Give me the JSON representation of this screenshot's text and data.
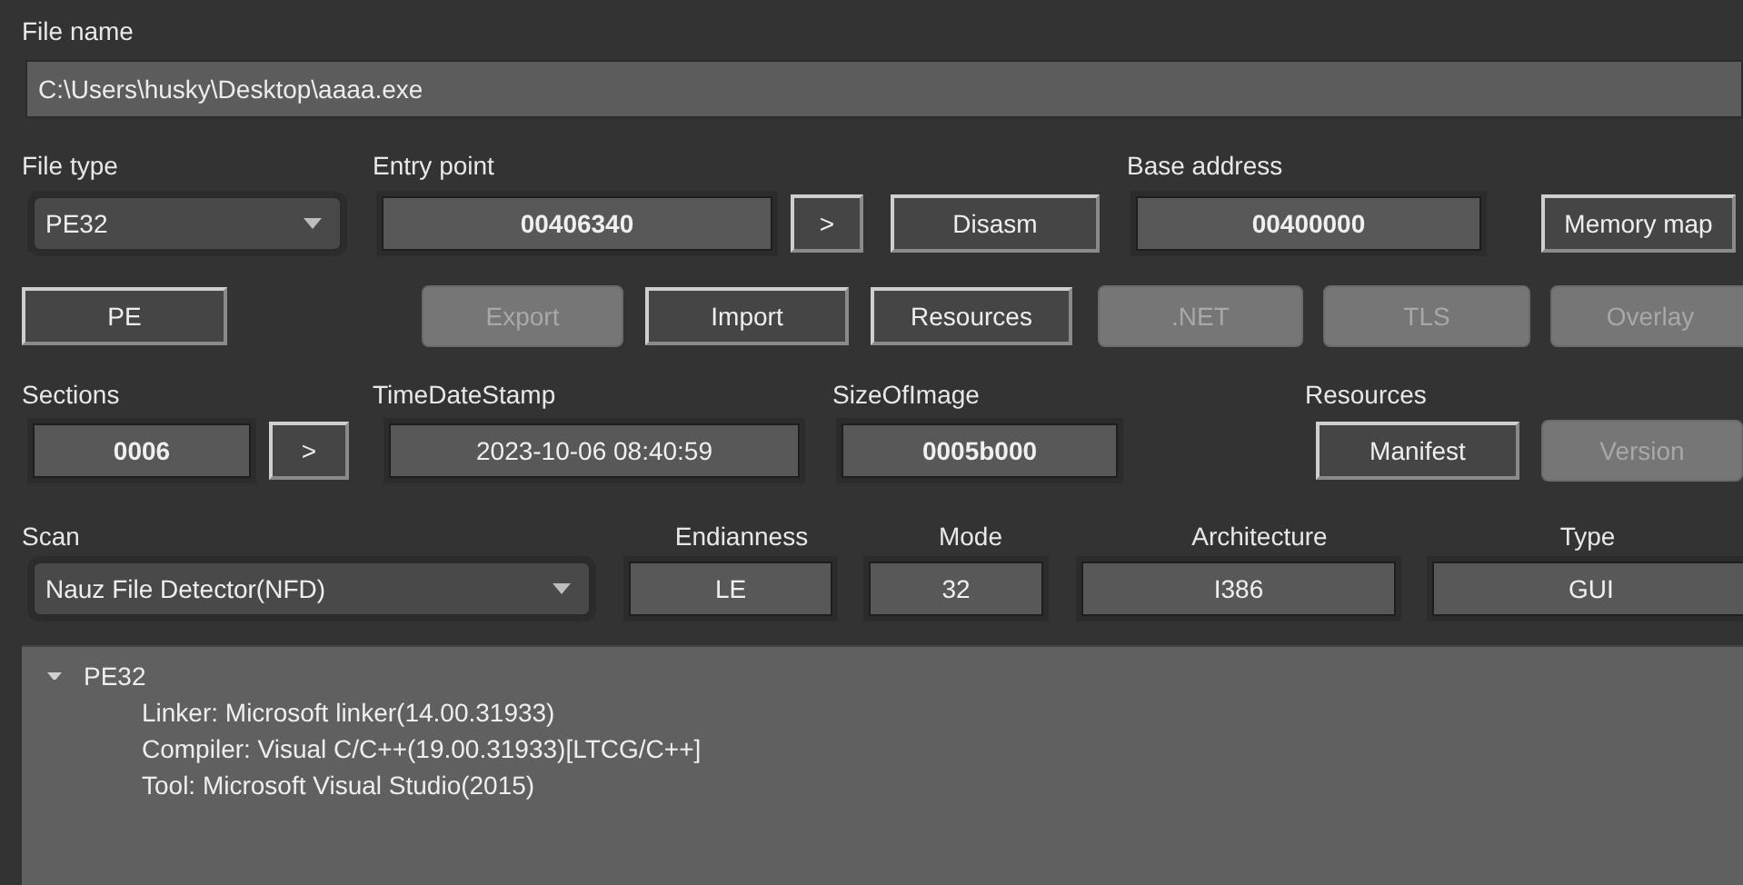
{
  "file_name": {
    "label": "File name",
    "value": "C:\\Users\\husky\\Desktop\\aaaa.exe"
  },
  "file_type": {
    "label": "File type",
    "value": "PE32"
  },
  "entry_point": {
    "label": "Entry point",
    "value": "00406340",
    "bold": true,
    "buttons": [
      {
        "label": ">",
        "disabled": false
      },
      {
        "label": "Disasm",
        "disabled": false
      }
    ]
  },
  "base_address": {
    "label": "Base address",
    "value": "00400000",
    "bold": true,
    "buttons": [
      {
        "label": "Memory map",
        "disabled": false
      }
    ]
  },
  "info_buttons": [
    {
      "label": "PE",
      "disabled": false
    },
    {
      "label": "Export",
      "disabled": true
    },
    {
      "label": "Import",
      "disabled": false
    },
    {
      "label": "Resources",
      "disabled": false
    },
    {
      "label": ".NET",
      "disabled": true
    },
    {
      "label": "TLS",
      "disabled": true
    },
    {
      "label": "Overlay",
      "disabled": true
    }
  ],
  "sections": {
    "label": "Sections",
    "value": "0006",
    "bold": true,
    "buttons": [
      {
        "label": ">",
        "disabled": false
      }
    ]
  },
  "time_date_stamp": {
    "label": "TimeDateStamp",
    "value": "2023-10-06 08:40:59",
    "bold": false
  },
  "size_of_image": {
    "label": "SizeOfImage",
    "value": "0005b000",
    "bold": true
  },
  "resources": {
    "label": "Resources",
    "buttons": [
      {
        "label": "Manifest",
        "disabled": false
      },
      {
        "label": "Version",
        "disabled": true
      }
    ]
  },
  "scan": {
    "label": "Scan",
    "value": "Nauz File Detector(NFD)"
  },
  "endianness": {
    "label": "Endianness",
    "value": "LE",
    "bold": false
  },
  "mode": {
    "label": "Mode",
    "value": "32",
    "bold": false
  },
  "architecture": {
    "label": "Architecture",
    "value": "I386",
    "bold": false
  },
  "type": {
    "label": "Type",
    "value": "GUI",
    "bold": false
  },
  "results": [
    {
      "label": "PE32",
      "expanded": true,
      "children": [
        {
          "label": "Linker: Microsoft linker(14.00.31933)"
        },
        {
          "label": "Compiler: Visual C/C++(19.00.31933)[LTCG/C++]"
        },
        {
          "label": "Tool: Microsoft Visual Studio(2015)"
        }
      ]
    }
  ]
}
